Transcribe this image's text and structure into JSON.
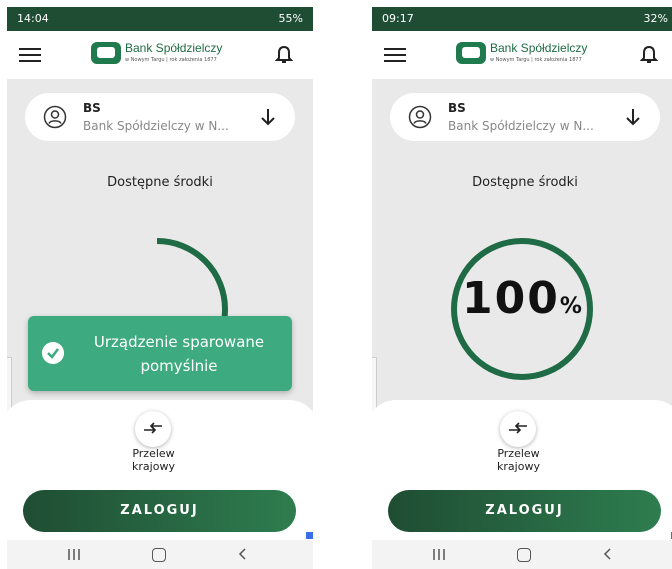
{
  "left": {
    "status": {
      "time": "14:04",
      "battery": "55%"
    },
    "toast": {
      "line1": "Urządzenie sparowane",
      "line2": "pomyślnie"
    },
    "gauge_level": 0.33
  },
  "right": {
    "status": {
      "time": "09:17",
      "battery": "32%"
    },
    "gauge_value": "100",
    "gauge_unit": "%",
    "gauge_level": 1.0
  },
  "common": {
    "bank_name": "Bank Spółdzielczy",
    "bank_tagline": "w Nowym Targu | rok założenia 1877",
    "account_title": "BS",
    "account_subtitle": "Bank Spółdzielczy w N...",
    "funds_label": "Dostępne środki",
    "transfer_label_line1": "Przelew",
    "transfer_label_line2": "krajowy",
    "login_label": "ZALOGUJ"
  },
  "colors": {
    "brand_dark": "#1f4d33",
    "brand": "#1f7a4d",
    "toast": "#3daa7f"
  },
  "icons": [
    "hamburger-menu-icon",
    "bell-icon",
    "user-icon",
    "arrow-down-icon",
    "check-icon",
    "transfer-arrows-icon",
    "recent-apps-icon",
    "home-icon",
    "back-icon"
  ]
}
